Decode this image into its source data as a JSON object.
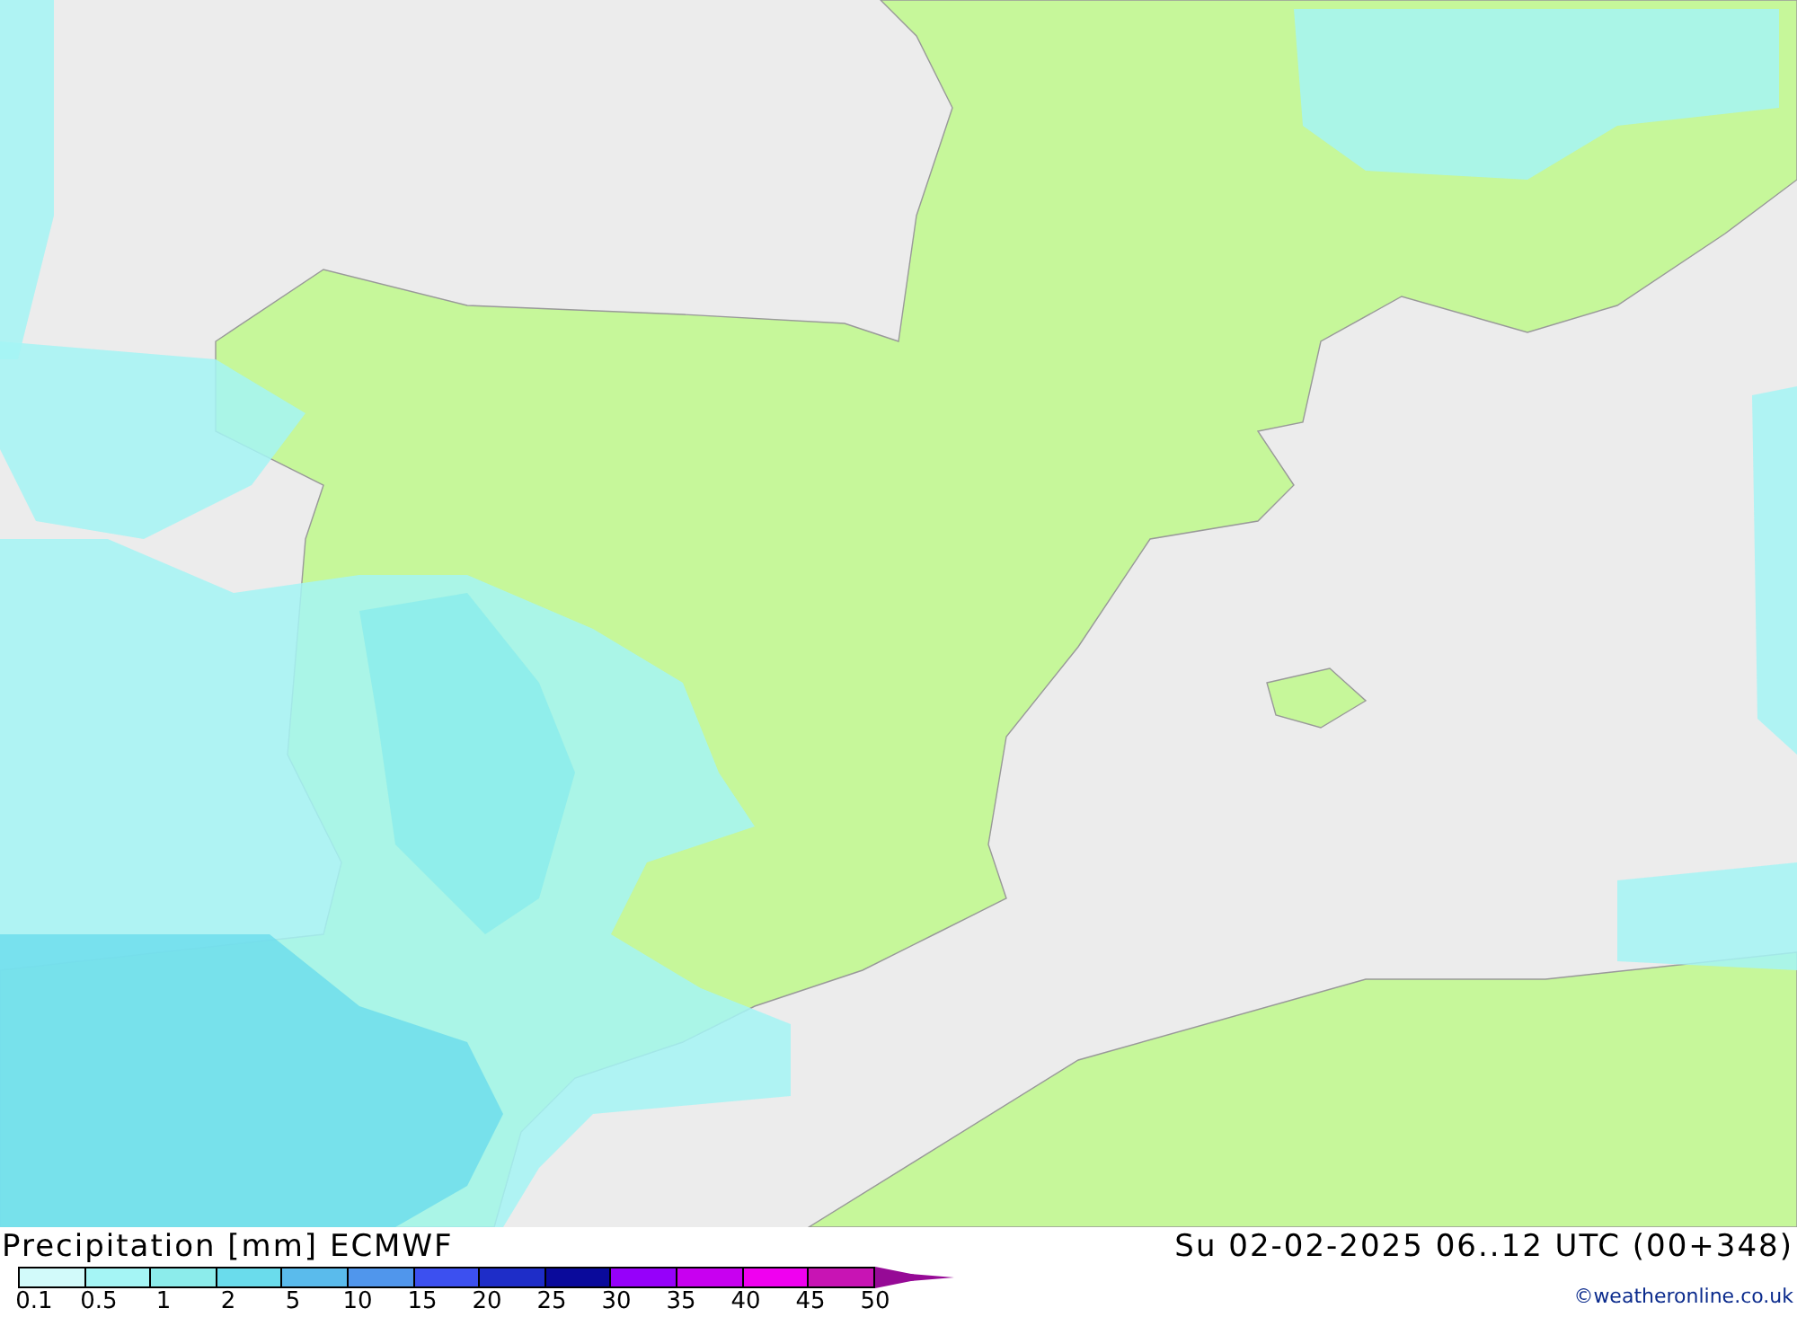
{
  "title": "Precipitation [mm] ECMWF",
  "valid_time": "Su 02-02-2025 06..12 UTC (00+348)",
  "legend": [
    {
      "label": "0.1",
      "color": "#d2fafa"
    },
    {
      "label": "0.5",
      "color": "#a5f5f5"
    },
    {
      "label": "1",
      "color": "#8ceceb"
    },
    {
      "label": "2",
      "color": "#6adcec"
    },
    {
      "label": "5",
      "color": "#5abbec"
    },
    {
      "label": "10",
      "color": "#5096ec"
    },
    {
      "label": "15",
      "color": "#3c50f0"
    },
    {
      "label": "20",
      "color": "#1e2dc8"
    },
    {
      "label": "25",
      "color": "#0a0a9b"
    },
    {
      "label": "30",
      "color": "#9600fa"
    },
    {
      "label": "35",
      "color": "#c800f0"
    },
    {
      "label": "40",
      "color": "#f000f0"
    },
    {
      "label": "45",
      "color": "#c814b4"
    },
    {
      "label": "50",
      "color": "#960a96"
    }
  ],
  "credit": "©weatheronline.co.uk"
}
